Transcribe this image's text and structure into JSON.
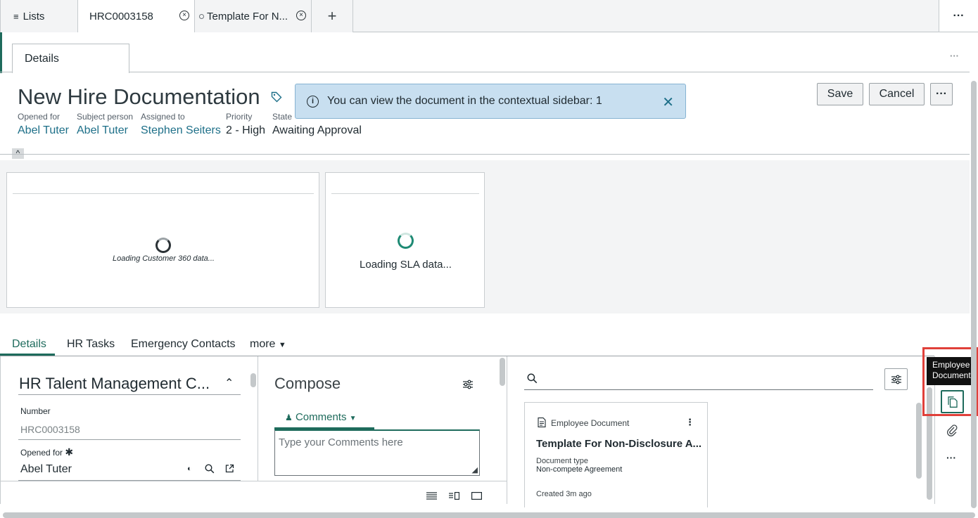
{
  "tabs": {
    "lists_label": "Lists",
    "record_label": "HRC0003158",
    "template_label": "Template For N...",
    "add_label": "+",
    "more_label": "···"
  },
  "details_tab": {
    "label": "Details",
    "more_label": "···"
  },
  "record": {
    "title": "New Hire Documentation",
    "fields": [
      {
        "label": "Opened for",
        "value": "Abel Tuter"
      },
      {
        "label": "Subject person",
        "value": "Abel Tuter"
      },
      {
        "label": "Assigned to",
        "value": "Stephen Seiters"
      },
      {
        "label": "Priority",
        "value": "2 - High"
      },
      {
        "label": "State",
        "value": "Awaiting Approval"
      }
    ]
  },
  "banner": {
    "icon": "info-icon",
    "message": "You can view the document in the contextual sidebar: 1"
  },
  "actions": {
    "save_label": "Save",
    "cancel_label": "Cancel",
    "more_label": "···"
  },
  "loading": {
    "customer360": "Loading Customer 360 data...",
    "sla": "Loading SLA data..."
  },
  "content_tabs": {
    "details": "Details",
    "hr_tasks": "HR Tasks",
    "emergency_contacts": "Emergency Contacts",
    "more": "more"
  },
  "form": {
    "section_title": "HR Talent Management C...",
    "number_label": "Number",
    "number_value": "HRC0003158",
    "opened_for_label": "Opened for",
    "opened_for_value": "Abel Tuter"
  },
  "compose": {
    "title": "Compose",
    "comments_tab": "Comments",
    "placeholder": "Type your Comments here"
  },
  "documents": {
    "search_placeholder": "",
    "card_type": "Employee Document",
    "card_title": "Template For Non-Disclosure A...",
    "doc_type_label": "Document type",
    "doc_type_value": "Non-compete Agreement",
    "created": "Created 3m ago"
  },
  "sidebar": {
    "tooltip": "Employee Documents",
    "more_label": "···"
  },
  "colors": {
    "accent": "#1e6b5c",
    "link": "#1d6f88",
    "banner_bg": "#c8dff0",
    "highlight": "#e0403a"
  }
}
